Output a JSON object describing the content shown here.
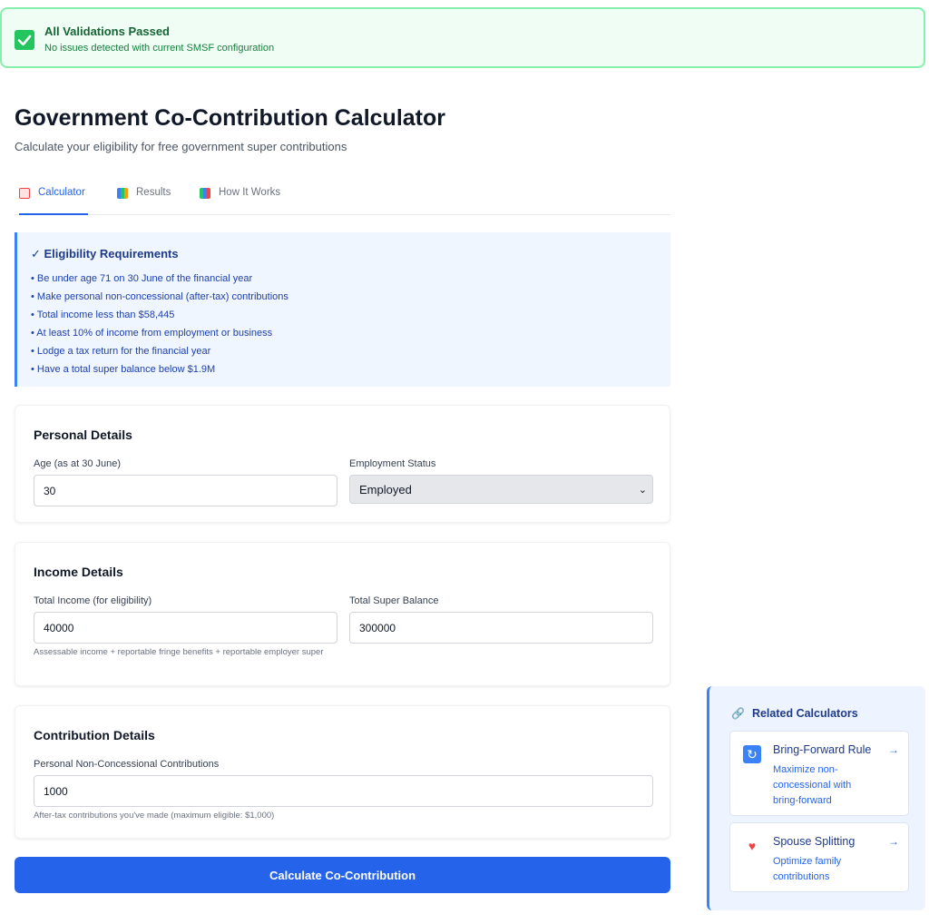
{
  "banner": {
    "title": "All Validations Passed",
    "subtitle": "No issues detected with current SMSF configuration"
  },
  "header": {
    "title": "Government Co-Contribution Calculator",
    "subtitle": "Calculate your eligibility for free government super contributions"
  },
  "tabs": [
    {
      "label": "Calculator",
      "icon": "abacus-icon",
      "active": true
    },
    {
      "label": "Results",
      "icon": "bar-chart-icon",
      "active": false
    },
    {
      "label": "How It Works",
      "icon": "books-icon",
      "active": false
    }
  ],
  "eligibility": {
    "title": "✓ Eligibility Requirements",
    "items": [
      "• Be under age 71 on 30 June of the financial year",
      "• Make personal non-concessional (after-tax) contributions",
      "• Total income less than $58,445",
      "• At least 10% of income from employment or business",
      "• Lodge a tax return for the financial year",
      "• Have a total super balance below $1.9M"
    ]
  },
  "personal": {
    "title": "Personal Details",
    "age_label": "Age (as at 30 June)",
    "age_value": "30",
    "employment_label": "Employment Status",
    "employment_value": "Employed"
  },
  "income": {
    "title": "Income Details",
    "total_income_label": "Total Income (for eligibility)",
    "total_income_value": "40000",
    "total_income_hint": "Assessable income + reportable fringe benefits + reportable employer super",
    "super_balance_label": "Total Super Balance",
    "super_balance_value": "300000"
  },
  "contribution": {
    "title": "Contribution Details",
    "ncc_label": "Personal Non-Concessional Contributions",
    "ncc_value": "1000",
    "ncc_hint": "After-tax contributions you've made (maximum eligible: $1,000)"
  },
  "cta": {
    "label": "Calculate Co-Contribution"
  },
  "related": {
    "title": "Related Calculators",
    "items": [
      {
        "name": "Bring-Forward Rule",
        "desc": "Maximize non-concessional with bring-forward",
        "icon": "refresh-icon",
        "arrow": "→"
      },
      {
        "name": "Spouse Splitting",
        "desc": "Optimize family contributions",
        "icon": "couple-heart-icon",
        "arrow": "→"
      }
    ]
  },
  "colors": {
    "accent": "#2563eb",
    "success": "#22c55e",
    "info_bg": "#eff6ff"
  }
}
